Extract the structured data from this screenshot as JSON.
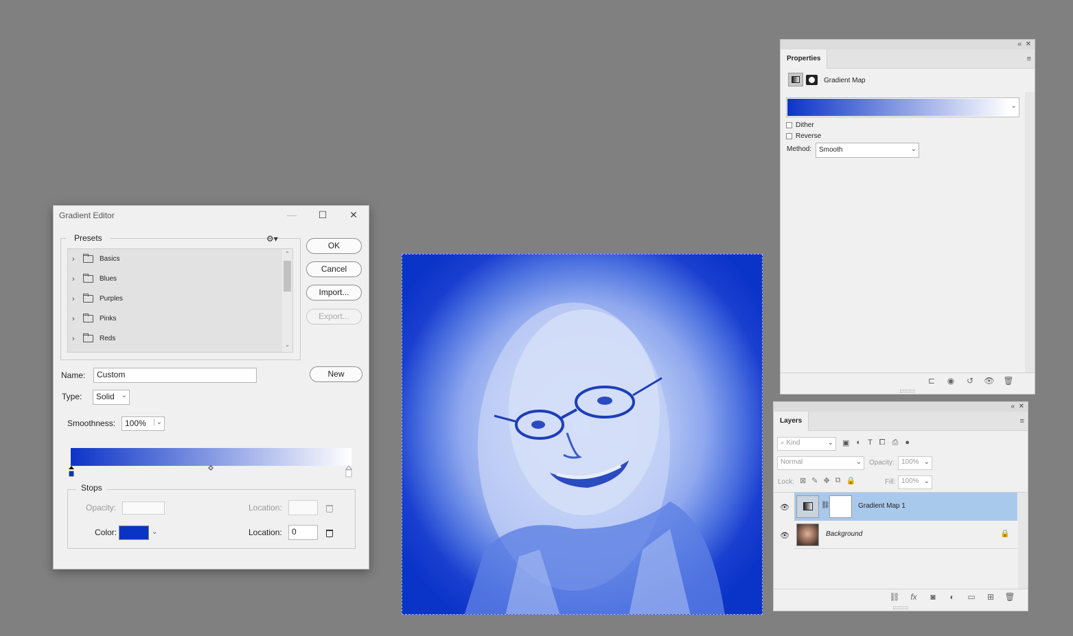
{
  "gradient_editor": {
    "title": "Gradient Editor",
    "presets_label": "Presets",
    "presets": [
      "Basics",
      "Blues",
      "Purples",
      "Pinks",
      "Reds"
    ],
    "buttons": {
      "ok": "OK",
      "cancel": "Cancel",
      "import": "Import...",
      "export": "Export...",
      "new": "New"
    },
    "name_label": "Name:",
    "name_value": "Custom",
    "type_label": "Type:",
    "type_value": "Solid",
    "smoothness_label": "Smoothness:",
    "smoothness_value": "100%",
    "gradient_colors": [
      "#0c34c8",
      "#ffffff"
    ],
    "stops": {
      "legend": "Stops",
      "opacity_label": "Opacity:",
      "opacity_value": "",
      "location_label": "Location:",
      "opacity_location_value": "",
      "color_label": "Color:",
      "color_value": "#0a34c4",
      "color_location_value": "0"
    }
  },
  "properties": {
    "tab": "Properties",
    "adjustment": "Gradient Map",
    "dither_label": "Dither",
    "reverse_label": "Reverse",
    "method_label": "Method:",
    "method_value": "Smooth"
  },
  "layers": {
    "tab": "Layers",
    "kind_placeholder": "Kind",
    "blend_mode": "Normal",
    "opacity_label": "Opacity:",
    "opacity_value": "100%",
    "lock_label": "Lock:",
    "fill_label": "Fill:",
    "fill_value": "100%",
    "items": [
      {
        "name": "Gradient Map 1",
        "selected": true
      },
      {
        "name": "Background",
        "locked": true
      }
    ]
  }
}
